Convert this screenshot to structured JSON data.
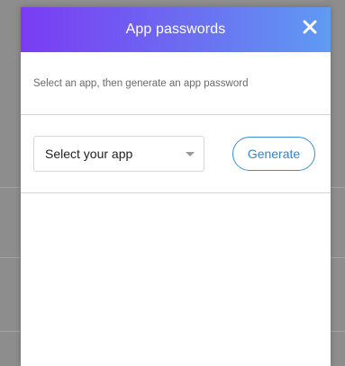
{
  "dialog": {
    "title": "App passwords",
    "close_icon": "close-icon",
    "description": "Select an app, then generate an app password",
    "app_select": {
      "selected": "Select your app",
      "icon": "chevron-down-icon"
    },
    "generate_label": "Generate"
  },
  "colors": {
    "header_gradient_start": "#7a3cf3",
    "header_gradient_end": "#5f9bf3",
    "accent": "#3b8fd6",
    "overlay": "#8d8d8d"
  }
}
